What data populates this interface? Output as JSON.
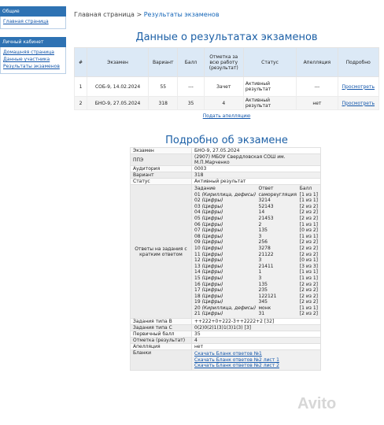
{
  "sidebar": {
    "section1_title": "Общие",
    "section1_items": [
      {
        "label": "Главная страница"
      }
    ],
    "section2_title": "Личный кабинет",
    "section2_items": [
      {
        "label": "Домашняя страница"
      },
      {
        "label": "Данные участника"
      },
      {
        "label": "Результаты экзаменов"
      }
    ]
  },
  "breadcrumb": {
    "home": "Главная страница",
    "separator": ">",
    "current": "Результаты экзаменов"
  },
  "results": {
    "title": "Данные о результатах экзаменов",
    "columns": [
      "#",
      "Экзамен",
      "Вариант",
      "Балл",
      "Отметка за всю работу (результат)",
      "Статус",
      "Апелляция",
      "Подробно"
    ],
    "rows": [
      {
        "n": "1",
        "exam": "СОБ-9, 14.02.2024",
        "variant": "55",
        "score": "---",
        "mark": "Зачет",
        "status": "Активный результат",
        "appeal": "---",
        "detail": "Просмотреть"
      },
      {
        "n": "2",
        "exam": "БНО-9, 27.05.2024",
        "variant": "318",
        "score": "35",
        "mark": "4",
        "status": "Активный результат",
        "appeal": "нет",
        "detail": "Просмотреть"
      }
    ],
    "appeal_link": "Подать апелляцию"
  },
  "details": {
    "title": "Подробно об экзамене",
    "exam_label": "Экзамен",
    "exam": "БНО-9, 27.05.2024",
    "ppe_label": "ППЭ",
    "ppe": "(2907) МБОУ Свердловская СОШ им. М.П.Марченко",
    "room_label": "Аудитория",
    "room": "0003",
    "variant_label": "Вариант",
    "variant": "318",
    "status_label": "Статус",
    "status": "Активный результат",
    "answers_label": "Ответы на задания с кратким ответом",
    "answers_header": {
      "task": "Задание",
      "answer": "Ответ",
      "score": "Балл"
    },
    "answers": [
      {
        "num": "01",
        "type": "(Кириллица, дефисы)",
        "answer": "самореугляция",
        "score": "[1 из 1]"
      },
      {
        "num": "02",
        "type": "(Цифры)",
        "answer": "3214",
        "score": "[1 из 1]"
      },
      {
        "num": "03",
        "type": "(Цифры)",
        "answer": "52143",
        "score": "[2 из 2]"
      },
      {
        "num": "04",
        "type": "(Цифры)",
        "answer": "14",
        "score": "[2 из 2]"
      },
      {
        "num": "05",
        "type": "(Цифры)",
        "answer": "21453",
        "score": "[2 из 2]"
      },
      {
        "num": "06",
        "type": "(Цифры)",
        "answer": "2",
        "score": "[1 из 1]"
      },
      {
        "num": "07",
        "type": "(Цифры)",
        "answer": "135",
        "score": "[0 из 2]"
      },
      {
        "num": "08",
        "type": "(Цифры)",
        "answer": "3",
        "score": "[1 из 1]"
      },
      {
        "num": "09",
        "type": "(Цифры)",
        "answer": "256",
        "score": "[2 из 2]"
      },
      {
        "num": "10",
        "type": "(Цифры)",
        "answer": "3278",
        "score": "[2 из 2]"
      },
      {
        "num": "11",
        "type": "(Цифры)",
        "answer": "21122",
        "score": "[2 из 2]"
      },
      {
        "num": "12",
        "type": "(Цифры)",
        "answer": "3",
        "score": "[0 из 1]"
      },
      {
        "num": "13",
        "type": "(Цифры)",
        "answer": "21411",
        "score": "[3 из 3]"
      },
      {
        "num": "14",
        "type": "(Цифры)",
        "answer": "1",
        "score": "[1 из 1]"
      },
      {
        "num": "15",
        "type": "(Цифры)",
        "answer": "3",
        "score": "[1 из 1]"
      },
      {
        "num": "16",
        "type": "(Цифры)",
        "answer": "135",
        "score": "[2 из 2]"
      },
      {
        "num": "17",
        "type": "(Цифры)",
        "answer": "235",
        "score": "[2 из 2]"
      },
      {
        "num": "18",
        "type": "(Цифры)",
        "answer": "122121",
        "score": "[2 из 2]"
      },
      {
        "num": "19",
        "type": "(Цифры)",
        "answer": "345",
        "score": "[2 из 2]"
      },
      {
        "num": "20",
        "type": "(Кириллица, дефисы)",
        "answer": "монк",
        "score": "[1 из 1]"
      },
      {
        "num": "21",
        "type": "(Цифры)",
        "answer": "31",
        "score": "[2 из 2]"
      }
    ],
    "typeB_label": "Задания типа B",
    "typeB": "++222+0+222-3++2222+2",
    "typeB_total": "[32]",
    "typeC_label": "Задания типа C",
    "typeC": "0(2)0(2)1(3)1(3)1(3)",
    "typeC_total": "[3]",
    "primary_label": "Первичный балл",
    "primary": "35",
    "mark_label": "Отметка (результат)",
    "mark": "4",
    "appeal_label": "Апелляция",
    "appeal": "нет",
    "blanks_label": "Бланки",
    "blanks": [
      {
        "label": "Скачать Бланк ответов №1"
      },
      {
        "label": "Скачать Бланк ответов №2 лист 1"
      },
      {
        "label": "Скачать Бланк ответов №2 лист 2"
      }
    ]
  },
  "watermark": "Avito"
}
